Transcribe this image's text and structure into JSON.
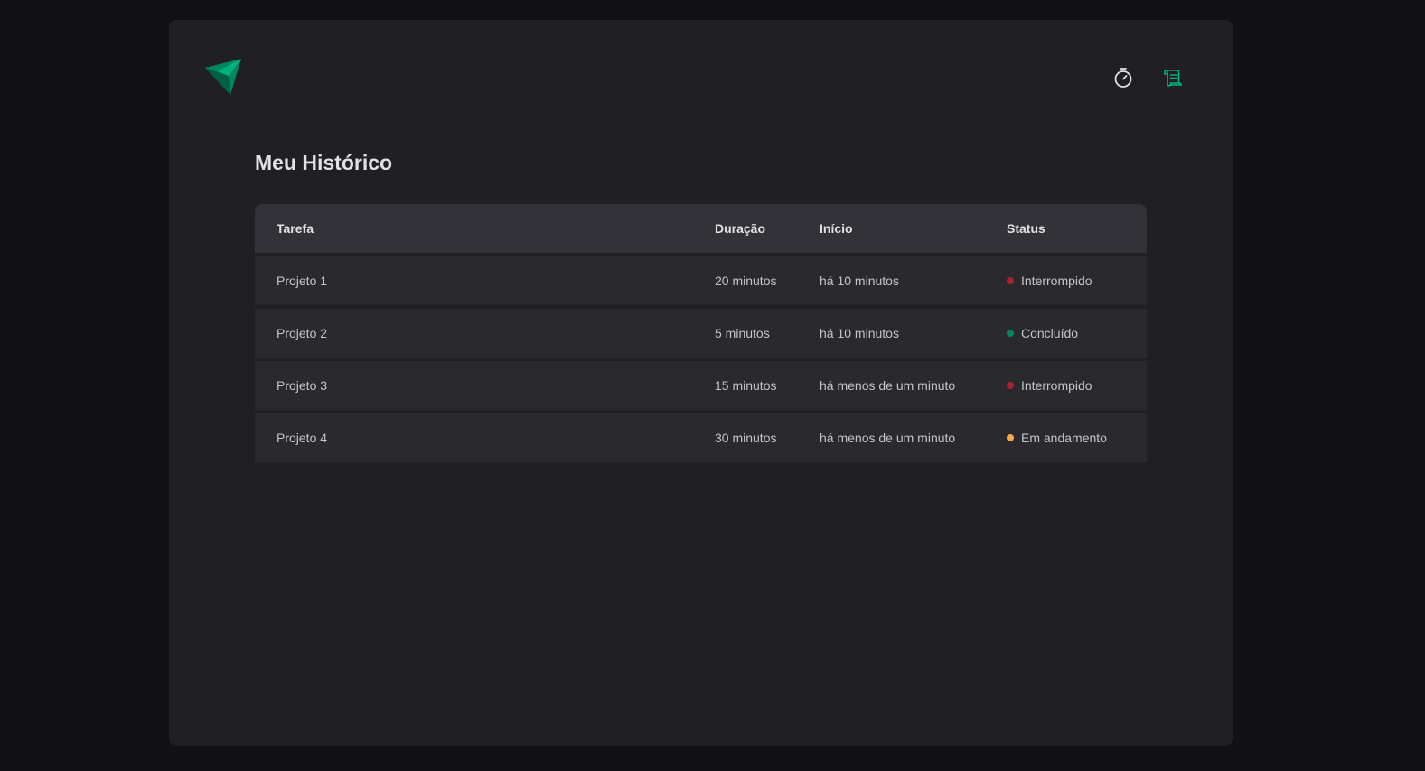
{
  "colors": {
    "background": "#121214",
    "panel": "#202024",
    "header_row": "#323238",
    "row": "#29292e",
    "brand_green": "#00875f",
    "status_red": "#ab222e",
    "status_green": "#00875f",
    "status_yellow": "#fba94c"
  },
  "header": {
    "logo_icon": "ignite-logo-icon",
    "nav": [
      {
        "icon": "timer-icon",
        "active": false
      },
      {
        "icon": "scroll-icon",
        "active": true
      }
    ]
  },
  "page": {
    "title": "Meu Histórico"
  },
  "table": {
    "columns": [
      "Tarefa",
      "Duração",
      "Início",
      "Status"
    ],
    "rows": [
      {
        "task": "Projeto 1",
        "duration": "20 minutos",
        "start": "há 10 minutos",
        "status": "Interrompido",
        "status_color": "#ab222e"
      },
      {
        "task": "Projeto 2",
        "duration": "5 minutos",
        "start": "há 10 minutos",
        "status": "Concluído",
        "status_color": "#00875f"
      },
      {
        "task": "Projeto 3",
        "duration": "15 minutos",
        "start": "há menos de um minuto",
        "status": "Interrompido",
        "status_color": "#ab222e"
      },
      {
        "task": "Projeto 4",
        "duration": "30 minutos",
        "start": "há menos de um minuto",
        "status": "Em andamento",
        "status_color": "#fba94c"
      }
    ]
  }
}
